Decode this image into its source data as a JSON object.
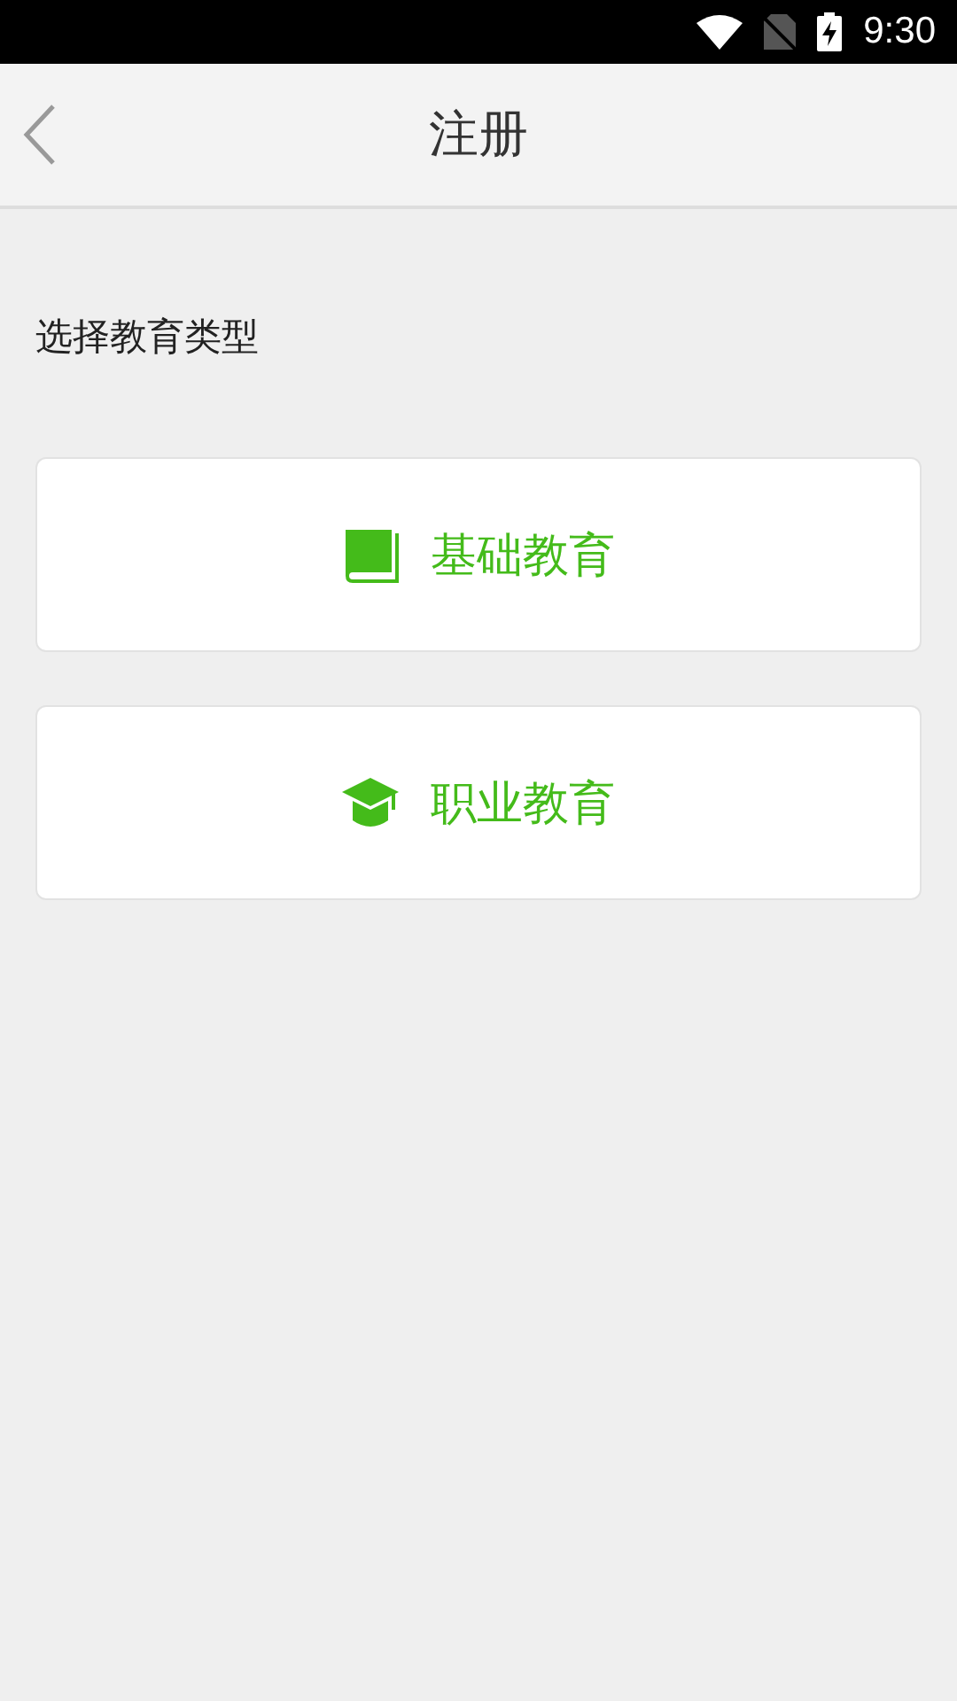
{
  "status_bar": {
    "time": "9:30"
  },
  "header": {
    "title": "注册"
  },
  "prompt": "选择教育类型",
  "options": [
    {
      "kind": "book",
      "label": "基础教育"
    },
    {
      "kind": "cap",
      "label": "职业教育"
    }
  ]
}
